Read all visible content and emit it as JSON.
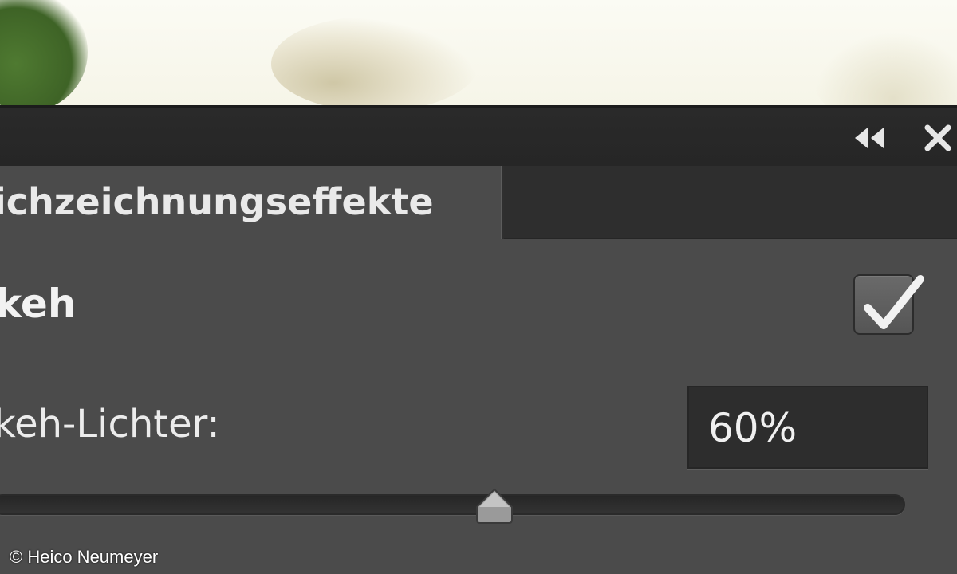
{
  "panel": {
    "tab_label": "ichzeichnungseffekte",
    "section_label": "keh",
    "section_checked": true,
    "field_label": "keh-Lichter:",
    "field_value": "60%",
    "slider_value_fraction": 0.55
  },
  "titlebar": {
    "collapse_icon": "double-chevron-left-icon",
    "close_icon": "close-icon"
  },
  "credit": "© Heico Neumeyer",
  "colors": {
    "panel_bg": "#4b4b4b",
    "titlebar_bg": "#282828",
    "field_bg": "#2d2d2d",
    "text": "#ececec"
  }
}
